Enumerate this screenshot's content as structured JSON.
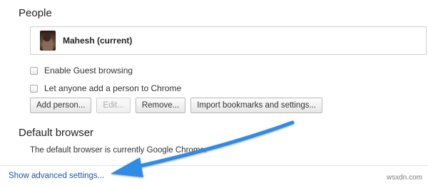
{
  "people": {
    "title": "People",
    "profiles": [
      {
        "name": "Mahesh (current)"
      }
    ],
    "options": [
      {
        "label": "Enable Guest browsing",
        "checked": false
      },
      {
        "label": "Let anyone add a person to Chrome",
        "checked": false
      }
    ],
    "buttons": {
      "add": "Add person...",
      "edit": "Edit...",
      "remove": "Remove...",
      "import": "Import bookmarks and settings..."
    }
  },
  "default_browser": {
    "title": "Default browser",
    "status": "The default browser is currently Google Chrome."
  },
  "advanced_link": "Show advanced settings...",
  "watermark": "wsxdn.com",
  "colors": {
    "link": "#1f55a6",
    "annotation_arrow": "#2f8be6"
  },
  "icons": {
    "annotation": "arrow-icon",
    "avatar": "profile-photo"
  }
}
